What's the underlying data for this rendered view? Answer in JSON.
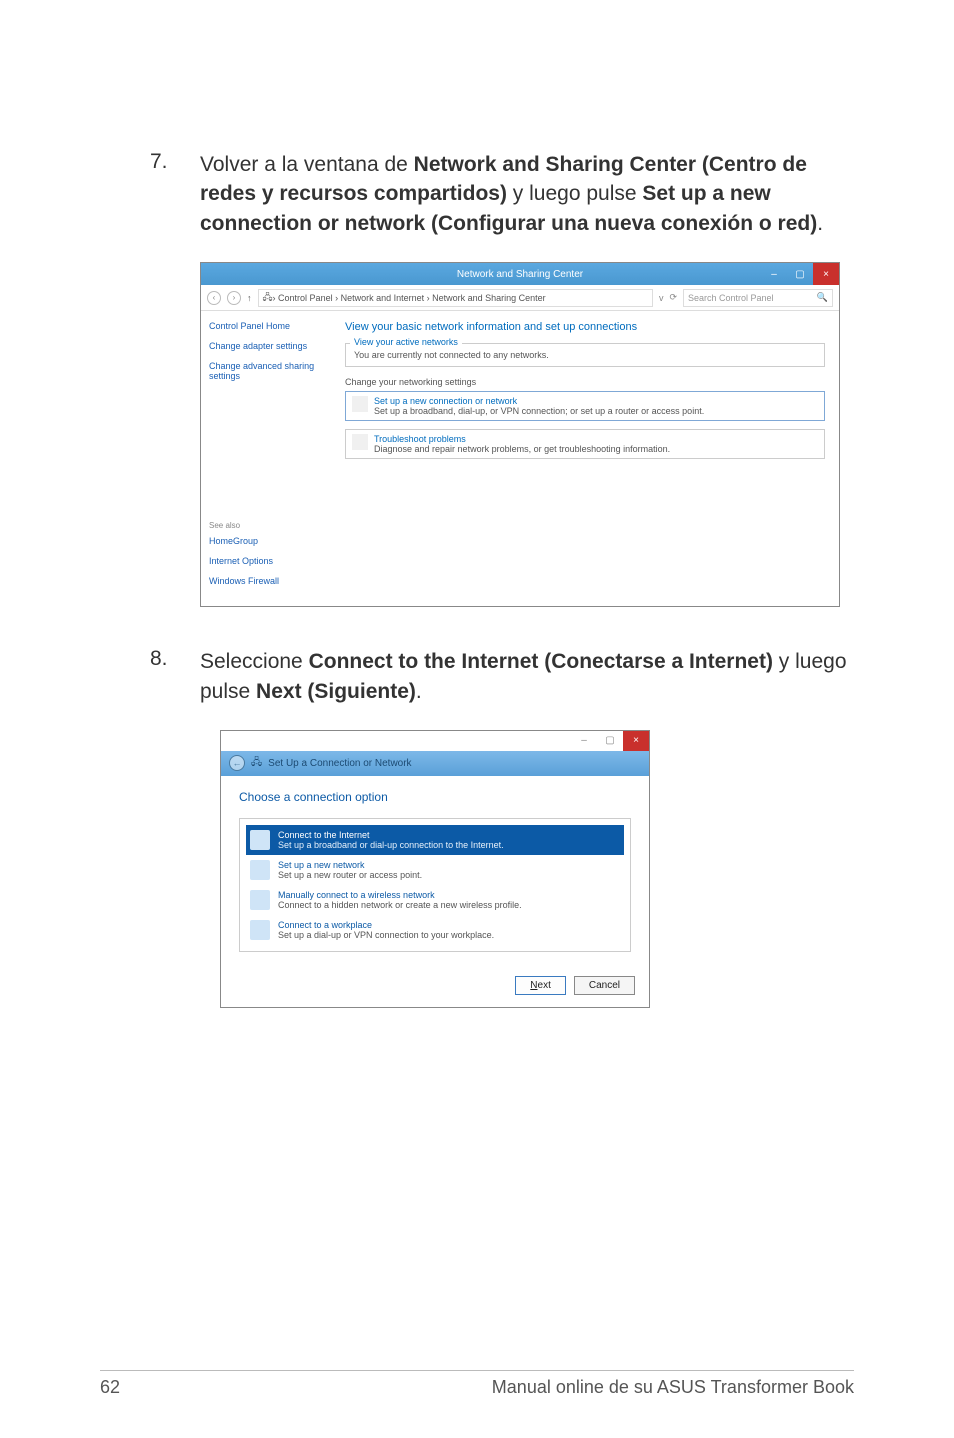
{
  "step7": {
    "num": "7.",
    "text_pre": "Volver a la ventana de ",
    "b1": "Network and Sharing Center (Centro de redes y recursos compartidos)",
    "text_mid": " y luego pulse ",
    "b2": "Set up a new connection or network (Configurar una nueva conexión o red)",
    "text_post": "."
  },
  "step8": {
    "num": "8.",
    "text_pre": "Seleccione ",
    "b1": "Connect to the Internet (Conectarse a Internet)",
    "text_mid": " y luego pulse ",
    "b2": "Next (Siguiente)",
    "text_post": "."
  },
  "shot1": {
    "title": "Network and Sharing Center",
    "min": "–",
    "max": "▢",
    "close": "×",
    "uparrow": "↑",
    "path": " › Control Panel › Network and Internet › Network and Sharing Center",
    "refresh_sep": "⟳",
    "search_placeholder": "Search Control Panel",
    "sidebar": {
      "home": "Control Panel Home",
      "adapter": "Change adapter settings",
      "advanced": "Change advanced sharing settings",
      "seealso": "See also",
      "homegroup": "HomeGroup",
      "inetopt": "Internet Options",
      "firewall": "Windows Firewall"
    },
    "main": {
      "head": "View your basic network information and set up connections",
      "active_legend": "View your active networks",
      "active_msg": "You are currently not connected to any networks.",
      "cyn": "Change your networking settings",
      "a1_title": "Set up a new connection or network",
      "a1_desc": "Set up a broadband, dial-up, or VPN connection; or set up a router or access point.",
      "a2_title": "Troubleshoot problems",
      "a2_desc": "Diagnose and repair network problems, or get troubleshooting information."
    }
  },
  "shot2": {
    "min": "–",
    "max": "▢",
    "close": "×",
    "back": "←",
    "header": "Set Up a Connection or Network",
    "h2": "Choose a connection option",
    "opts": [
      {
        "title": "Connect to the Internet",
        "desc": "Set up a broadband or dial-up connection to the Internet."
      },
      {
        "title": "Set up a new network",
        "desc": "Set up a new router or access point."
      },
      {
        "title": "Manually connect to a wireless network",
        "desc": "Connect to a hidden network or create a new wireless profile."
      },
      {
        "title": "Connect to a workplace",
        "desc": "Set up a dial-up or VPN connection to your workplace."
      }
    ],
    "next_u": "N",
    "next_rest": "ext",
    "cancel": "Cancel"
  },
  "footer": {
    "pagenum": "62",
    "footertext": "Manual online de su ASUS Transformer Book"
  }
}
